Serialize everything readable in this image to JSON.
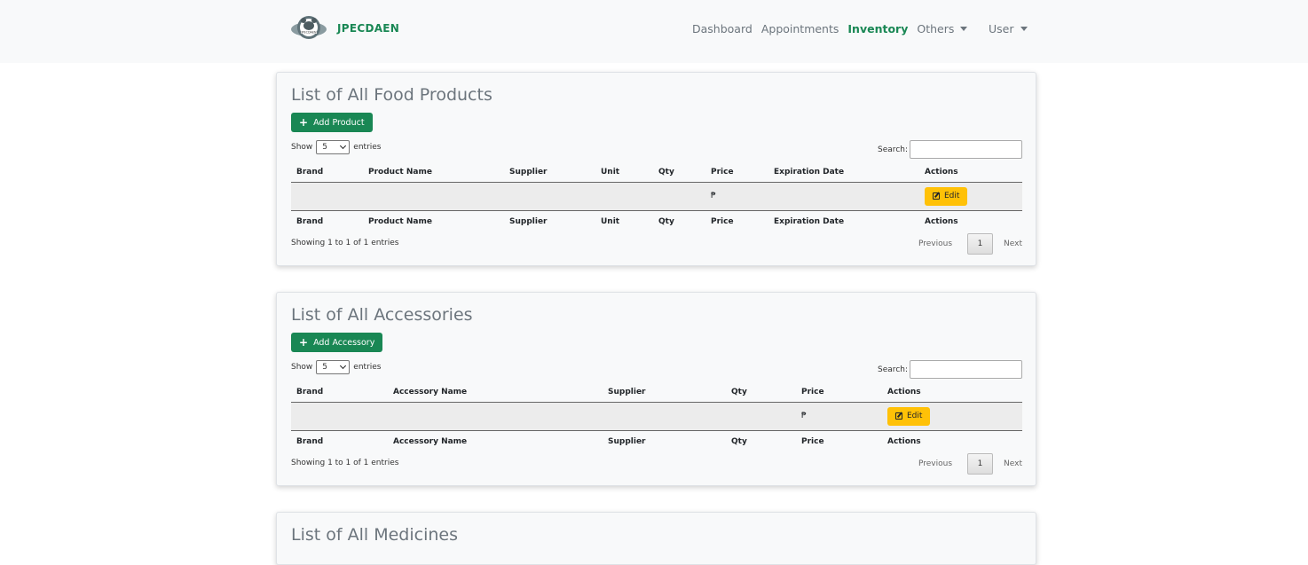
{
  "app": {
    "brand": "JPECDAEN",
    "logo_text": "JPECDAEN"
  },
  "nav": {
    "dashboard": "Dashboard",
    "appointments": "Appointments",
    "inventory": "Inventory",
    "others": "Others",
    "user": "User"
  },
  "food": {
    "title": "List of All Food Products",
    "add_label": "Add Product",
    "show_label": "Show",
    "entries_label": "entries",
    "page_size": "5",
    "search_label": "Search:",
    "columns": [
      "Brand",
      "Product Name",
      "Supplier",
      "Unit",
      "Qty",
      "Price",
      "Expiration Date",
      "Actions"
    ],
    "row": {
      "brand": "",
      "product_name": "",
      "supplier": "",
      "unit": "",
      "qty": "",
      "price": "₱",
      "expiration_date": "",
      "action": "Edit"
    },
    "info": "Showing 1 to 1 of 1 entries",
    "pager": {
      "prev": "Previous",
      "page": "1",
      "next": "Next"
    }
  },
  "accessories": {
    "title": "List of All Accessories",
    "add_label": "Add Accessory",
    "show_label": "Show",
    "entries_label": "entries",
    "page_size": "5",
    "search_label": "Search:",
    "columns": [
      "Brand",
      "Accessory Name",
      "Supplier",
      "Qty",
      "Price",
      "Actions"
    ],
    "row": {
      "brand": "",
      "accessory_name": "",
      "supplier": "",
      "qty": "",
      "price": "₱",
      "action": "Edit"
    },
    "info": "Showing 1 to 1 of 1 entries",
    "pager": {
      "prev": "Previous",
      "page": "1",
      "next": "Next"
    }
  },
  "medicines": {
    "title": "List of All Medicines"
  },
  "colors": {
    "brand_green": "#198754",
    "edit_yellow": "#ffc107",
    "navbar_bg": "#f8f9fa"
  }
}
